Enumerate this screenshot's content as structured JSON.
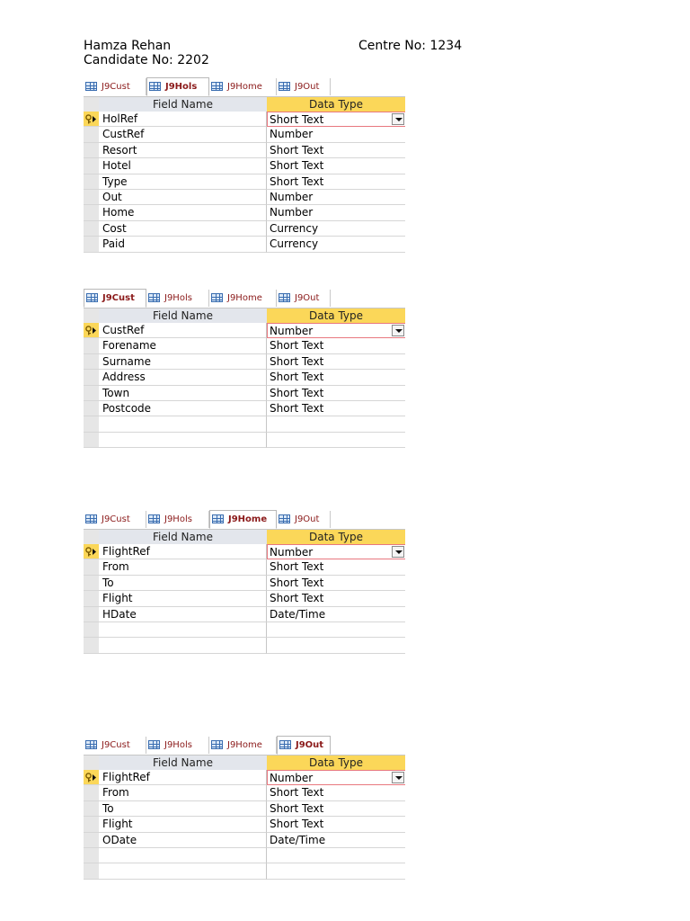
{
  "header": {
    "name": "Hamza Rehan",
    "centre": "Centre No: 1234",
    "candidate": "Candidate No: 2202"
  },
  "tab_labels": [
    "J9Cust",
    "J9Hols",
    "J9Home",
    "J9Out"
  ],
  "column_headers": {
    "field_name": "Field Name",
    "data_type": "Data Type"
  },
  "tables": [
    {
      "active_tab": "J9Hols",
      "rows": [
        {
          "field": "HolRef",
          "type": "Short Text"
        },
        {
          "field": "CustRef",
          "type": "Number"
        },
        {
          "field": "Resort",
          "type": "Short Text"
        },
        {
          "field": "Hotel",
          "type": "Short Text"
        },
        {
          "field": "Type",
          "type": "Short Text"
        },
        {
          "field": "Out",
          "type": "Number"
        },
        {
          "field": "Home",
          "type": "Number"
        },
        {
          "field": "Cost",
          "type": "Currency"
        },
        {
          "field": "Paid",
          "type": "Currency"
        }
      ]
    },
    {
      "active_tab": "J9Cust",
      "rows": [
        {
          "field": "CustRef",
          "type": "Number"
        },
        {
          "field": "Forename",
          "type": "Short Text"
        },
        {
          "field": "Surname",
          "type": "Short Text"
        },
        {
          "field": "Address",
          "type": "Short Text"
        },
        {
          "field": "Town",
          "type": "Short Text"
        },
        {
          "field": "Postcode",
          "type": "Short Text"
        },
        {
          "field": "",
          "type": ""
        },
        {
          "field": "",
          "type": ""
        }
      ]
    },
    {
      "active_tab": "J9Home",
      "rows": [
        {
          "field": "FlightRef",
          "type": "Number"
        },
        {
          "field": "From",
          "type": "Short Text"
        },
        {
          "field": "To",
          "type": "Short Text"
        },
        {
          "field": "Flight",
          "type": "Short Text"
        },
        {
          "field": "HDate",
          "type": "Date/Time"
        },
        {
          "field": "",
          "type": ""
        },
        {
          "field": "",
          "type": ""
        }
      ]
    },
    {
      "active_tab": "J9Out",
      "rows": [
        {
          "field": "FlightRef",
          "type": "Number"
        },
        {
          "field": "From",
          "type": "Short Text"
        },
        {
          "field": "To",
          "type": "Short Text"
        },
        {
          "field": "Flight",
          "type": "Short Text"
        },
        {
          "field": "ODate",
          "type": "Date/Time"
        },
        {
          "field": "",
          "type": ""
        },
        {
          "field": "",
          "type": ""
        }
      ]
    }
  ],
  "icons": {
    "table_icon": "table-icon",
    "primary_key_icon": "primary-key-icon",
    "dropdown_icon": "dropdown-arrow-icon"
  }
}
